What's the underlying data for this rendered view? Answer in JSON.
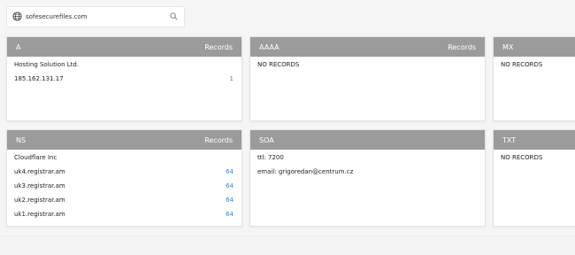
{
  "search": {
    "value": "sofesecurefiles.com",
    "globe_icon": "globe-icon",
    "search_icon": "search-icon"
  },
  "cards": {
    "a": {
      "title": "A",
      "records_label": "Records",
      "rows": [
        {
          "text": "Hosting Solution Ltd.",
          "count": ""
        },
        {
          "text": "185.162.131.17",
          "count": "1"
        }
      ]
    },
    "aaaa": {
      "title": "AAAA",
      "records_label": "Records",
      "rows": [
        {
          "text": "NO RECORDS",
          "count": ""
        }
      ]
    },
    "mx": {
      "title": "MX",
      "rows": [
        {
          "text": "NO RECORDS",
          "count": ""
        }
      ]
    },
    "ns": {
      "title": "NS",
      "records_label": "Records",
      "rows": [
        {
          "text": "Cloudflare Inc",
          "count": ""
        },
        {
          "text": "uk4.registrar.am",
          "count": "64"
        },
        {
          "text": "uk3.registrar.am",
          "count": "64"
        },
        {
          "text": "uk2.registrar.am",
          "count": "64"
        },
        {
          "text": "uk1.registrar.am",
          "count": "64"
        }
      ]
    },
    "soa": {
      "title": "SOA",
      "rows": [
        {
          "text": "ttl: 7200",
          "count": ""
        },
        {
          "text": "email: grigoredan@centrum.cz",
          "count": ""
        }
      ]
    },
    "txt": {
      "title": "TXT",
      "rows": [
        {
          "text": "NO RECORDS",
          "count": ""
        }
      ]
    }
  },
  "colors": {
    "header_bg": "#9b9b9b",
    "count_link": "#3a86d6",
    "page_bg": "#f5f5f5"
  }
}
